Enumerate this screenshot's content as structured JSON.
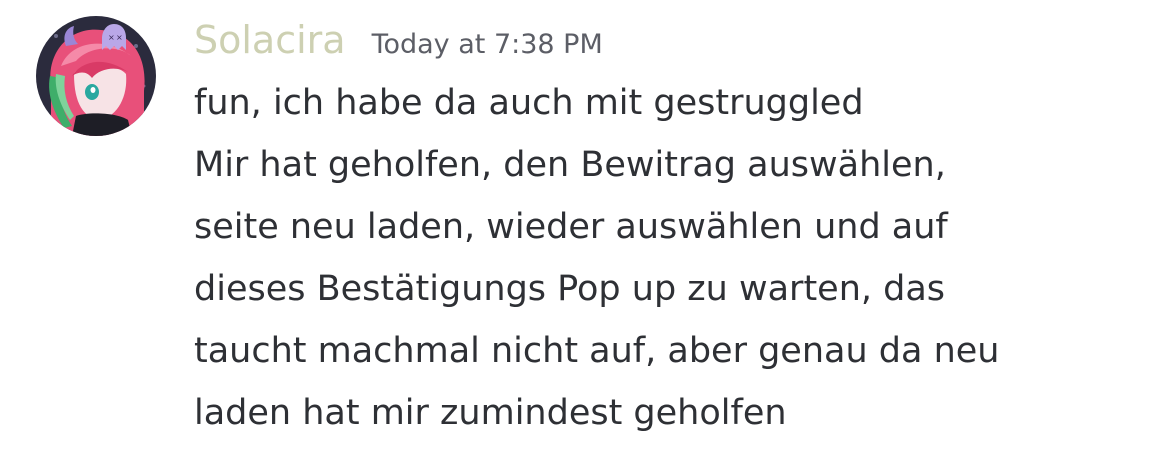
{
  "message": {
    "avatar_icon": "user-avatar-anime-character",
    "author": {
      "name": "Solacira",
      "color": "#cdd0b2"
    },
    "timestamp": "Today at 7:38 PM",
    "lines": [
      "fun, ich habe da auch mit gestruggled",
      "Mir hat geholfen, den Bewitrag auswählen,",
      "seite neu laden, wieder auswählen und auf",
      "dieses Bestätigungs Pop up zu warten, das",
      "taucht machmal nicht auf, aber genau da neu",
      "laden hat mir zumindest geholfen"
    ]
  }
}
